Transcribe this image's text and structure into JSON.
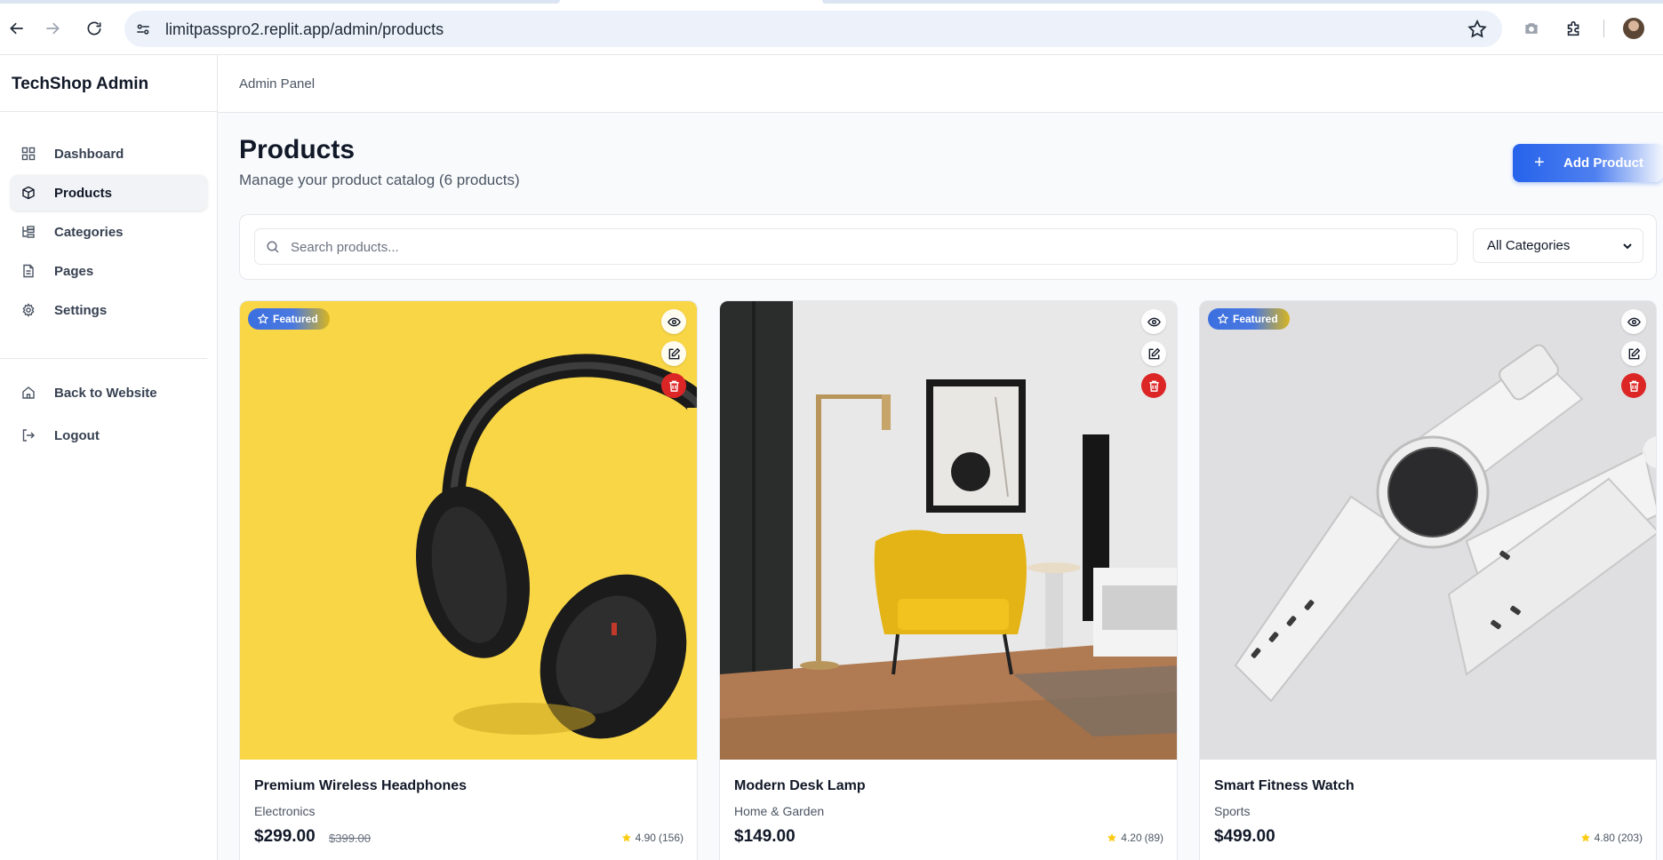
{
  "browser": {
    "url": "limitpasspro2.replit.app/admin/products"
  },
  "sidebar": {
    "brand": "TechShop Admin",
    "items": [
      {
        "label": "Dashboard",
        "icon": "grid-icon"
      },
      {
        "label": "Products",
        "icon": "box-icon",
        "active": true
      },
      {
        "label": "Categories",
        "icon": "hierarchy-icon"
      },
      {
        "label": "Pages",
        "icon": "document-icon"
      },
      {
        "label": "Settings",
        "icon": "gear-icon"
      }
    ],
    "bottom_items": [
      {
        "label": "Back to Website",
        "icon": "home-icon"
      },
      {
        "label": "Logout",
        "icon": "logout-icon"
      }
    ]
  },
  "header": {
    "breadcrumb": "Admin Panel"
  },
  "main": {
    "title": "Products",
    "subtitle": "Manage your product catalog (6 products)",
    "add_button": "Add Product",
    "search": {
      "placeholder": "Search products...",
      "value": ""
    },
    "category_filter": {
      "selected": "All Categories"
    }
  },
  "products": [
    {
      "name": "Premium Wireless Headphones",
      "category": "Electronics",
      "price": "$299.00",
      "old_price": "$399.00",
      "rating": "4.90",
      "reviews": "(156)",
      "featured": true,
      "featured_label": "Featured"
    },
    {
      "name": "Modern Desk Lamp",
      "category": "Home & Garden",
      "price": "$149.00",
      "rating": "4.20",
      "reviews": "(89)",
      "featured": false
    },
    {
      "name": "Smart Fitness Watch",
      "category": "Sports",
      "price": "$499.00",
      "rating": "4.80",
      "reviews": "(203)",
      "featured": true,
      "featured_label": "Featured"
    }
  ],
  "colors": {
    "accent": "#2563eb",
    "danger": "#dc2626",
    "star": "#facc15",
    "background": "#f8fafc"
  }
}
